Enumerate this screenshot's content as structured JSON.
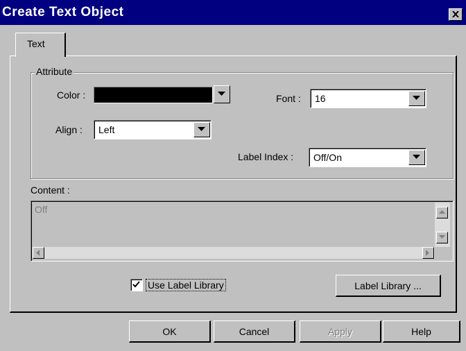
{
  "window": {
    "title": "Create Text Object",
    "close_icon": "close-icon"
  },
  "tabs": [
    {
      "label": "Text"
    }
  ],
  "attribute": {
    "group_label": "Attribute",
    "color_label": "Color :",
    "color_value": "#000000",
    "font_label": "Font :",
    "font_value": "16",
    "align_label": "Align :",
    "align_value": "Left",
    "label_index_label": "Label Index :",
    "label_index_value": "Off/On"
  },
  "content": {
    "label": "Content :",
    "value": "Off"
  },
  "use_label_library": {
    "label": "Use Label Library",
    "checked": true
  },
  "buttons": {
    "label_library": "Label Library ...",
    "ok": "OK",
    "cancel": "Cancel",
    "apply": "Apply",
    "help": "Help"
  }
}
